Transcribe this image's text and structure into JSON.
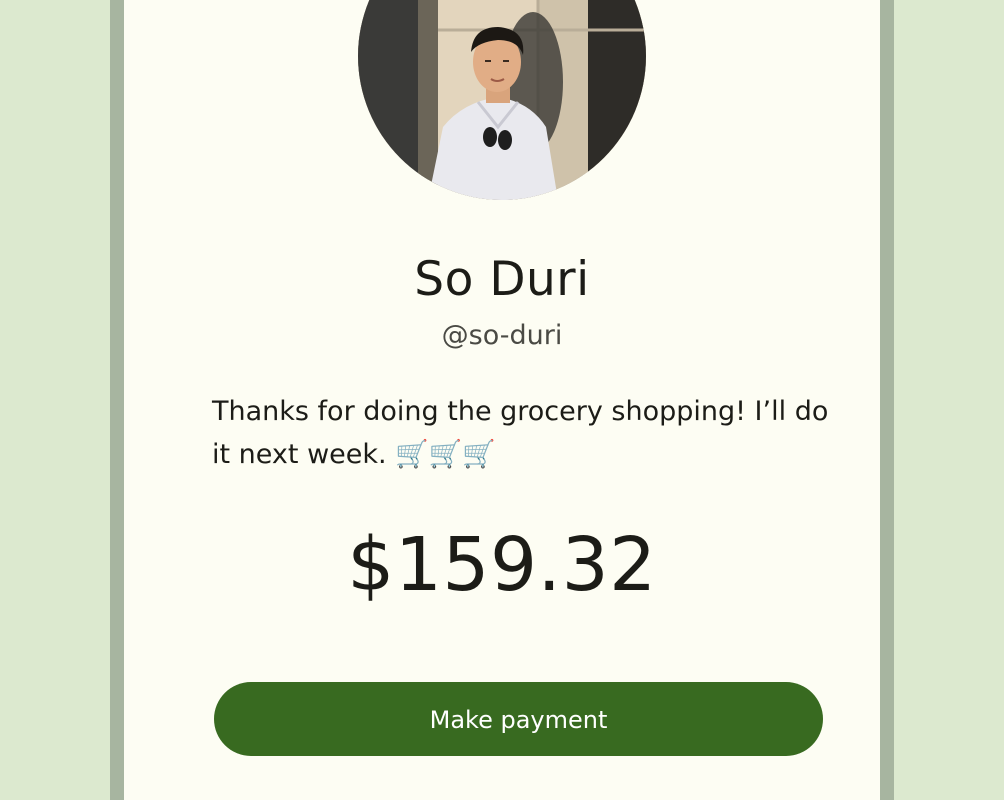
{
  "profile": {
    "name": "So Duri",
    "handle": "@so-duri",
    "avatar_icon": "person-photo"
  },
  "request": {
    "message": "Thanks for doing the grocery shopping! I’ll do it next week. 🛒🛒🛒",
    "amount": "$159.32"
  },
  "actions": {
    "pay_label": "Make payment"
  },
  "colors": {
    "background": "#dce9cf",
    "frame": "#a7b5a0",
    "card": "#fdfdf3",
    "primary": "#386a20"
  }
}
